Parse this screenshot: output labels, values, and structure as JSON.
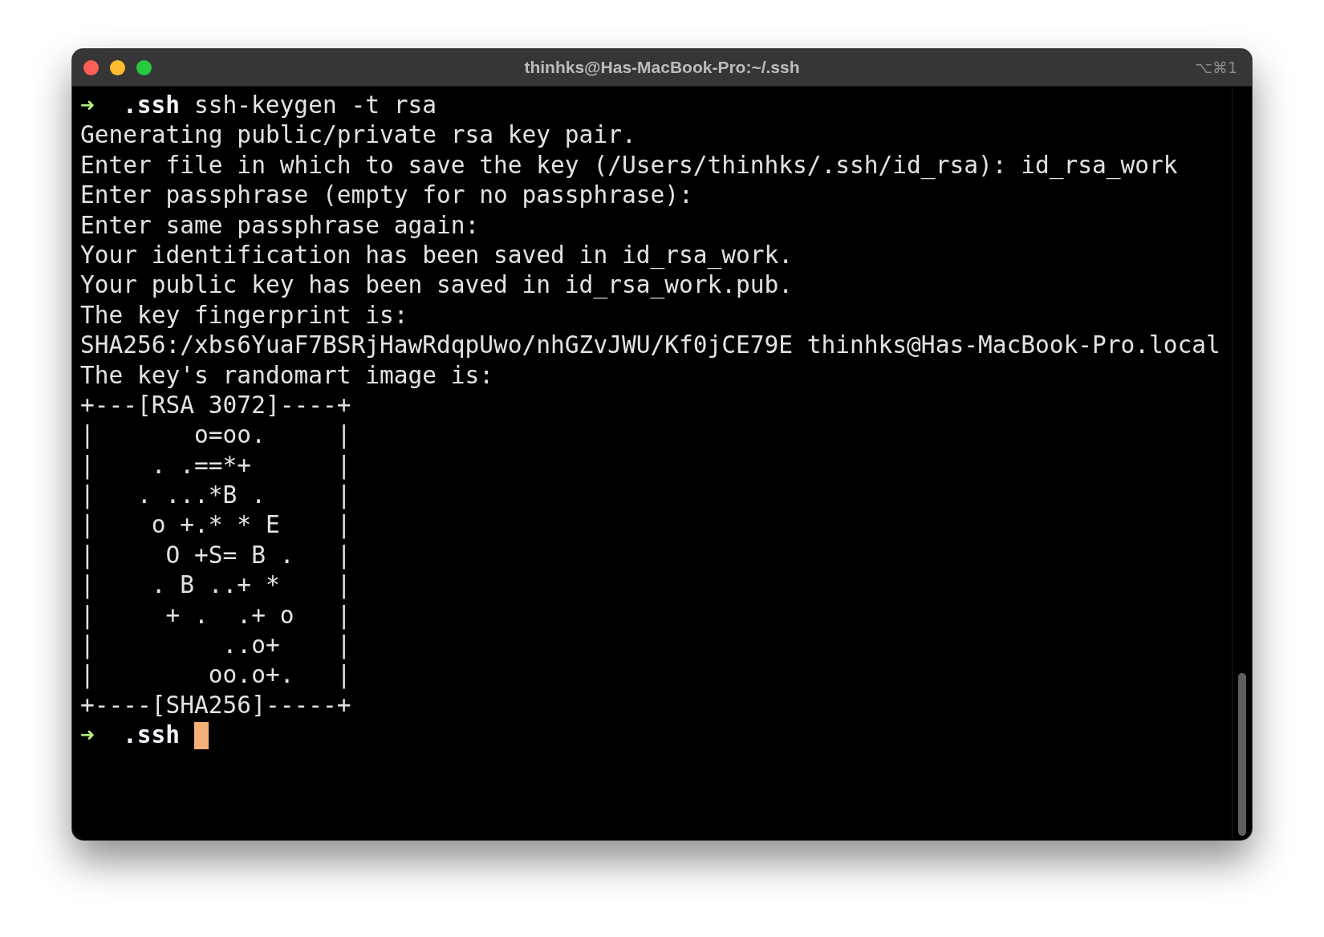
{
  "window": {
    "title": "thinhks@Has-MacBook-Pro:~/.ssh",
    "shortcut": "⌥⌘1"
  },
  "terminal": {
    "lines": [
      {
        "kind": "prompt",
        "arrow": "➜",
        "dir": ".ssh",
        "command": "ssh-keygen -t rsa",
        "cursor": false
      },
      {
        "kind": "output",
        "text": "Generating public/private rsa key pair."
      },
      {
        "kind": "output",
        "text": "Enter file in which to save the key (/Users/thinhks/.ssh/id_rsa): id_rsa_work"
      },
      {
        "kind": "output",
        "text": "Enter passphrase (empty for no passphrase):"
      },
      {
        "kind": "output",
        "text": "Enter same passphrase again:"
      },
      {
        "kind": "output",
        "text": "Your identification has been saved in id_rsa_work."
      },
      {
        "kind": "output",
        "text": "Your public key has been saved in id_rsa_work.pub."
      },
      {
        "kind": "output",
        "text": "The key fingerprint is:"
      },
      {
        "kind": "output",
        "text": "SHA256:/xbs6YuaF7BSRjHawRdqpUwo/nhGZvJWU/Kf0jCE79E thinhks@Has-MacBook-Pro.local"
      },
      {
        "kind": "output",
        "text": "The key's randomart image is:"
      },
      {
        "kind": "output",
        "text": "+---[RSA 3072]----+"
      },
      {
        "kind": "output",
        "text": "|       o=oo.     |"
      },
      {
        "kind": "output",
        "text": "|    . .==*+      |"
      },
      {
        "kind": "output",
        "text": "|   . ...*B .     |"
      },
      {
        "kind": "output",
        "text": "|    o +.* * E    |"
      },
      {
        "kind": "output",
        "text": "|     O +S= B .   |"
      },
      {
        "kind": "output",
        "text": "|    . B ..+ *    |"
      },
      {
        "kind": "output",
        "text": "|     + .  .+ o   |"
      },
      {
        "kind": "output",
        "text": "|         ..o+    |"
      },
      {
        "kind": "output",
        "text": "|        oo.o+.   |"
      },
      {
        "kind": "output",
        "text": "+----[SHA256]-----+"
      },
      {
        "kind": "prompt",
        "arrow": "➜",
        "dir": ".ssh",
        "cursor": true
      }
    ]
  }
}
